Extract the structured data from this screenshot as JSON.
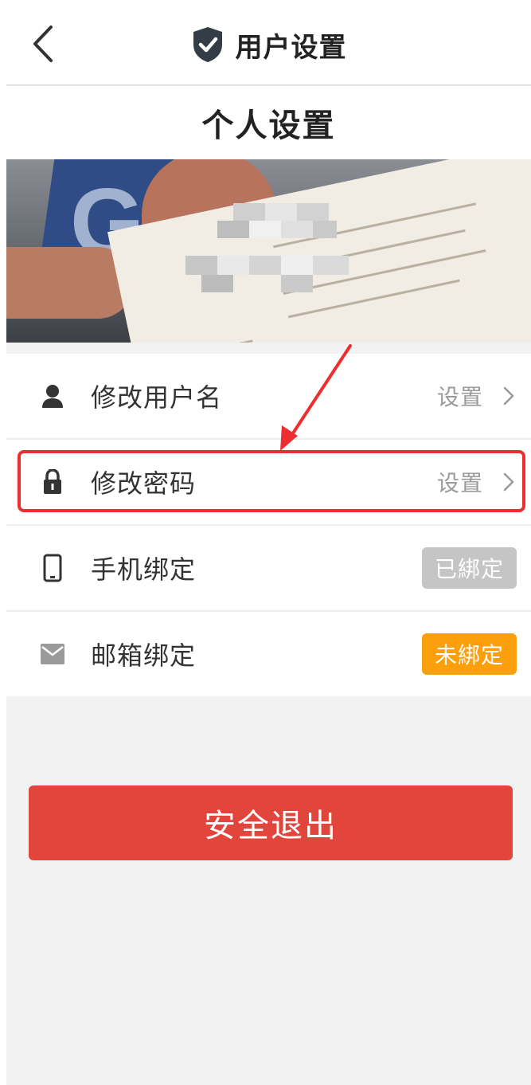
{
  "header": {
    "title": "用户设置",
    "back_icon": "chevron-left-icon",
    "title_icon": "shield-check-icon"
  },
  "section": {
    "title": "个人设置"
  },
  "settings": {
    "items": [
      {
        "label": "修改用户名",
        "icon": "user-icon",
        "action_label": "设置"
      },
      {
        "label": "修改密码",
        "icon": "lock-icon",
        "action_label": "设置"
      },
      {
        "label": "手机绑定",
        "icon": "phone-icon",
        "status": "已綁定"
      },
      {
        "label": "邮箱绑定",
        "icon": "mail-icon",
        "status": "未綁定"
      }
    ]
  },
  "logout": {
    "label": "安全退出"
  },
  "colors": {
    "accent_red": "#e2453b",
    "badge_bound": "#c5c5c5",
    "badge_unbound": "#fb9f0c",
    "highlight": "#ee2e2e"
  }
}
